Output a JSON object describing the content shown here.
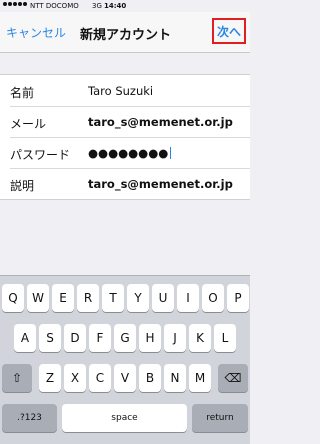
{
  "status_bar": {
    "carrier": "NTT DOCOMO",
    "network": "3G",
    "time": "14:40"
  },
  "nav": {
    "cancel": "キャンセル",
    "title": "新規アカウント",
    "next": "次へ"
  },
  "form": {
    "rows": [
      {
        "label": "名前",
        "value": "Taro Suzuki"
      },
      {
        "label": "メール",
        "value": "taro_s@memenet.or.jp"
      },
      {
        "label": "パスワード",
        "value": "●●●●●●●●"
      },
      {
        "label": "説明",
        "value": "taro_s@memenet.or.jp"
      }
    ]
  },
  "keyboard": {
    "row1": [
      "Q",
      "W",
      "E",
      "R",
      "T",
      "Y",
      "U",
      "I",
      "O",
      "P"
    ],
    "row2": [
      "A",
      "S",
      "D",
      "F",
      "G",
      "H",
      "J",
      "K",
      "L"
    ],
    "row3": [
      "Z",
      "X",
      "C",
      "V",
      "B",
      "N",
      "M"
    ],
    "shift": "⇧",
    "delete": "⌫",
    "num": ".?123",
    "space": "space",
    "return": "return"
  }
}
